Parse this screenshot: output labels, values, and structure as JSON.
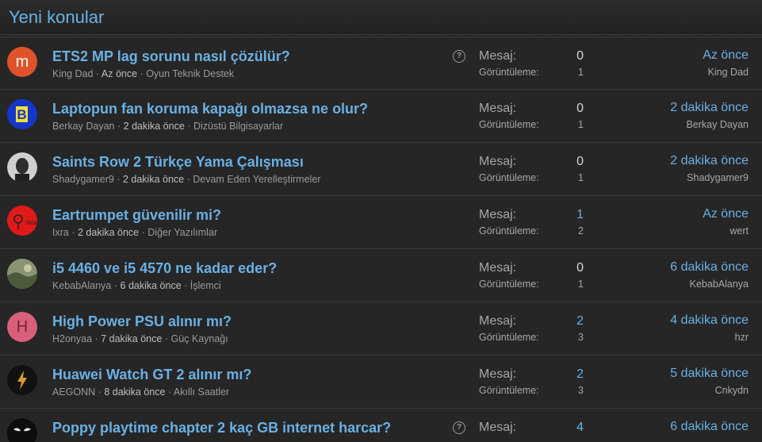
{
  "header": {
    "title": "Yeni konular"
  },
  "labels": {
    "replies": "Mesaj:",
    "views": "Görüntüleme:",
    "sep": "·"
  },
  "threads": [
    {
      "avatar_letter": "m",
      "avatar_color": "#e0522a",
      "title": "ETS2 MP lag sorunu nasıl çözülür?",
      "author": "King Dad",
      "time": "Az önce",
      "forum": "Oyun Teknik Destek",
      "replies": "0",
      "views": "1",
      "last_time": "Az önce",
      "last_user": "King Dad",
      "has_help": true
    },
    {
      "avatar_letter": "B",
      "avatar_color": "#1537c9",
      "title": "Laptopun fan koruma kapağı olmazsa ne olur?",
      "author": "Berkay Dayan",
      "time": "2 dakika önce",
      "forum": "Dizüstü Bilgisayarlar",
      "replies": "0",
      "views": "1",
      "last_time": "2 dakika önce",
      "last_user": "Berkay Dayan",
      "has_help": false
    },
    {
      "avatar_letter": "",
      "avatar_color": "#555555",
      "title": "Saints Row 2 Türkçe Yama Çalışması",
      "author": "Shadygamer9",
      "time": "2 dakika önce",
      "forum": "Devam Eden Yerelleştirmeler",
      "replies": "0",
      "views": "1",
      "last_time": "2 dakika önce",
      "last_user": "Shadygamer9",
      "has_help": false
    },
    {
      "avatar_letter": "",
      "avatar_color": "#e01919",
      "title": "Eartrumpet güvenilir mi?",
      "author": "Ixra",
      "time": "2 dakika önce",
      "forum": "Diğer Yazılımlar",
      "replies": "1",
      "views": "2",
      "last_time": "Az önce",
      "last_user": "wert",
      "has_help": false,
      "avatar_text": "Ixra"
    },
    {
      "avatar_letter": "",
      "avatar_color": "#6f7b5c",
      "title": "i5 4460 ve i5 4570 ne kadar eder?",
      "author": "KebabAlanya",
      "time": "6 dakika önce",
      "forum": "İşlemci",
      "replies": "0",
      "views": "1",
      "last_time": "6 dakika önce",
      "last_user": "KebabAlanya",
      "has_help": false
    },
    {
      "avatar_letter": "H",
      "avatar_color": "#d9607a",
      "title": "High Power PSU alınır mı?",
      "author": "H2onyaa",
      "time": "7 dakika önce",
      "forum": "Güç Kaynağı",
      "replies": "2",
      "views": "3",
      "last_time": "4 dakika önce",
      "last_user": "hzr",
      "has_help": false
    },
    {
      "avatar_letter": "",
      "avatar_color": "#111111",
      "title": "Huawei Watch GT 2 alınır mı?",
      "author": "AEGONN",
      "time": "8 dakika önce",
      "forum": "Akıllı Saatler",
      "replies": "2",
      "views": "3",
      "last_time": "5 dakika önce",
      "last_user": "Cnkydn",
      "has_help": false
    },
    {
      "avatar_letter": "",
      "avatar_color": "#111111",
      "title": "Poppy playtime chapter 2 kaç GB internet harcar?",
      "author": "",
      "time": "",
      "forum": "",
      "replies": "4",
      "views": "",
      "last_time": "6 dakika önce",
      "last_user": "",
      "has_help": true
    }
  ]
}
